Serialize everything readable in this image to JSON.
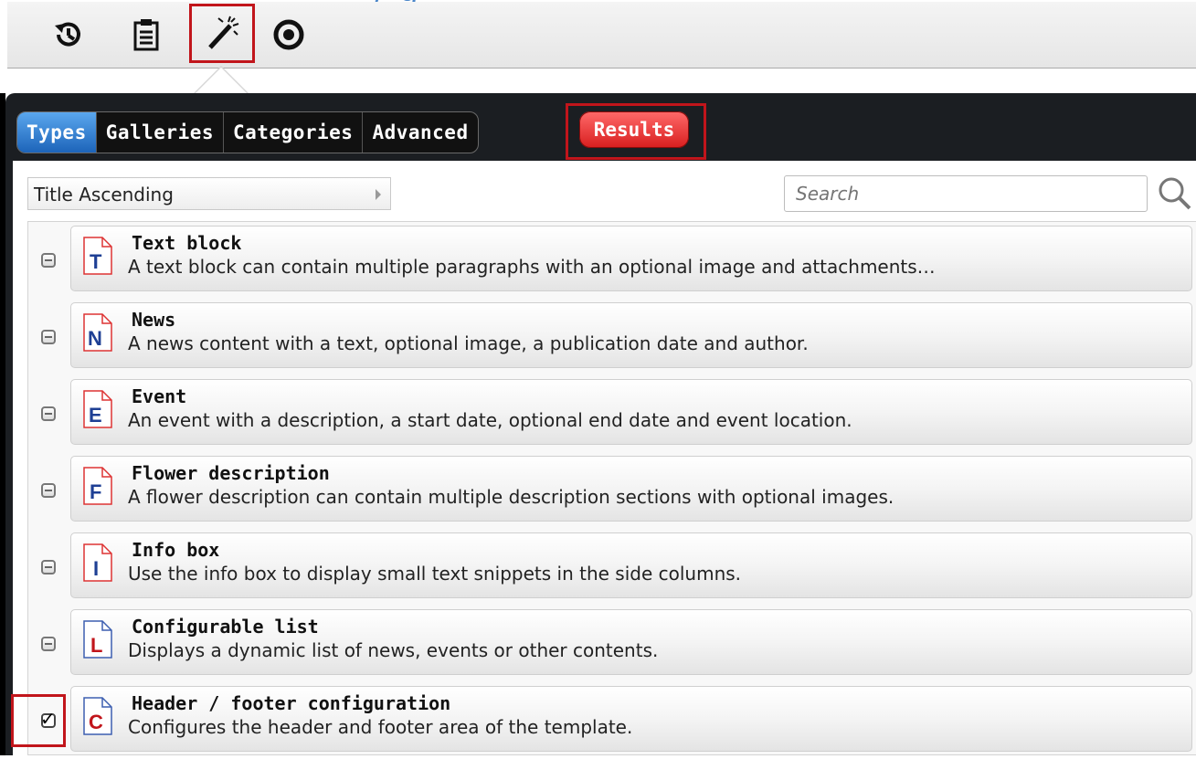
{
  "heading_fragment": "/   g",
  "toolbar": {
    "buttons": [
      {
        "name": "history",
        "icon": "history-icon"
      },
      {
        "name": "clipboard",
        "icon": "clipboard-icon"
      },
      {
        "name": "magic-wand",
        "icon": "magic-wand-icon",
        "selected": true
      },
      {
        "name": "target",
        "icon": "target-icon"
      }
    ]
  },
  "tabs": [
    {
      "label": "Types",
      "active": true
    },
    {
      "label": "Galleries",
      "active": false
    },
    {
      "label": "Categories",
      "active": false
    },
    {
      "label": "Advanced",
      "active": false
    }
  ],
  "results_label": "Results",
  "sort": {
    "value": "Title Ascending"
  },
  "search": {
    "placeholder": "Search"
  },
  "items": [
    {
      "title": "Text block",
      "description": "A text block can contain multiple paragraphs with an optional image and attachments…",
      "letter": "T",
      "letter_color": "#1e3f94",
      "checked": false
    },
    {
      "title": "News",
      "description": "A news content with a text, optional image, a publication date and author.",
      "letter": "N",
      "letter_color": "#1e3f94",
      "checked": false
    },
    {
      "title": "Event",
      "description": "An event with a description, a start date, optional end date and event location.",
      "letter": "E",
      "letter_color": "#1e3f94",
      "checked": false
    },
    {
      "title": "Flower description",
      "description": "A flower description can contain multiple description sections with optional images.",
      "letter": "F",
      "letter_color": "#1e3f94",
      "checked": false
    },
    {
      "title": "Info box",
      "description": "Use the info box to display small text snippets in the side columns.",
      "letter": "I",
      "letter_color": "#1e3f94",
      "checked": false
    },
    {
      "title": "Configurable list",
      "description": "Displays a dynamic list of news, events or other contents.",
      "letter": "L",
      "letter_color": "#c1151b",
      "checked": false
    },
    {
      "title": "Header / footer configuration",
      "description": "Configures the header and footer area of the template.",
      "letter": "C",
      "letter_color": "#c1151b",
      "checked": true
    }
  ],
  "colors": {
    "accent_blue": "#1d64b9",
    "highlight_red": "#c1151b",
    "results_red": "#d81e1e"
  }
}
